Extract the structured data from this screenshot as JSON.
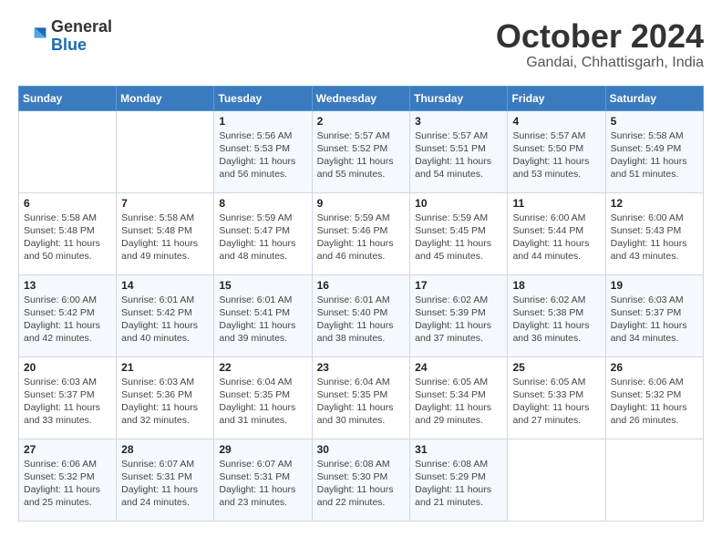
{
  "header": {
    "logo_line1": "General",
    "logo_line2": "Blue",
    "title": "October 2024",
    "subtitle": "Gandai, Chhattisgarh, India"
  },
  "days_of_week": [
    "Sunday",
    "Monday",
    "Tuesday",
    "Wednesday",
    "Thursday",
    "Friday",
    "Saturday"
  ],
  "weeks": [
    [
      {
        "day": "",
        "info": ""
      },
      {
        "day": "",
        "info": ""
      },
      {
        "day": "1",
        "info": "Sunrise: 5:56 AM\nSunset: 5:53 PM\nDaylight: 11 hours and 56 minutes."
      },
      {
        "day": "2",
        "info": "Sunrise: 5:57 AM\nSunset: 5:52 PM\nDaylight: 11 hours and 55 minutes."
      },
      {
        "day": "3",
        "info": "Sunrise: 5:57 AM\nSunset: 5:51 PM\nDaylight: 11 hours and 54 minutes."
      },
      {
        "day": "4",
        "info": "Sunrise: 5:57 AM\nSunset: 5:50 PM\nDaylight: 11 hours and 53 minutes."
      },
      {
        "day": "5",
        "info": "Sunrise: 5:58 AM\nSunset: 5:49 PM\nDaylight: 11 hours and 51 minutes."
      }
    ],
    [
      {
        "day": "6",
        "info": "Sunrise: 5:58 AM\nSunset: 5:48 PM\nDaylight: 11 hours and 50 minutes."
      },
      {
        "day": "7",
        "info": "Sunrise: 5:58 AM\nSunset: 5:48 PM\nDaylight: 11 hours and 49 minutes."
      },
      {
        "day": "8",
        "info": "Sunrise: 5:59 AM\nSunset: 5:47 PM\nDaylight: 11 hours and 48 minutes."
      },
      {
        "day": "9",
        "info": "Sunrise: 5:59 AM\nSunset: 5:46 PM\nDaylight: 11 hours and 46 minutes."
      },
      {
        "day": "10",
        "info": "Sunrise: 5:59 AM\nSunset: 5:45 PM\nDaylight: 11 hours and 45 minutes."
      },
      {
        "day": "11",
        "info": "Sunrise: 6:00 AM\nSunset: 5:44 PM\nDaylight: 11 hours and 44 minutes."
      },
      {
        "day": "12",
        "info": "Sunrise: 6:00 AM\nSunset: 5:43 PM\nDaylight: 11 hours and 43 minutes."
      }
    ],
    [
      {
        "day": "13",
        "info": "Sunrise: 6:00 AM\nSunset: 5:42 PM\nDaylight: 11 hours and 42 minutes."
      },
      {
        "day": "14",
        "info": "Sunrise: 6:01 AM\nSunset: 5:42 PM\nDaylight: 11 hours and 40 minutes."
      },
      {
        "day": "15",
        "info": "Sunrise: 6:01 AM\nSunset: 5:41 PM\nDaylight: 11 hours and 39 minutes."
      },
      {
        "day": "16",
        "info": "Sunrise: 6:01 AM\nSunset: 5:40 PM\nDaylight: 11 hours and 38 minutes."
      },
      {
        "day": "17",
        "info": "Sunrise: 6:02 AM\nSunset: 5:39 PM\nDaylight: 11 hours and 37 minutes."
      },
      {
        "day": "18",
        "info": "Sunrise: 6:02 AM\nSunset: 5:38 PM\nDaylight: 11 hours and 36 minutes."
      },
      {
        "day": "19",
        "info": "Sunrise: 6:03 AM\nSunset: 5:37 PM\nDaylight: 11 hours and 34 minutes."
      }
    ],
    [
      {
        "day": "20",
        "info": "Sunrise: 6:03 AM\nSunset: 5:37 PM\nDaylight: 11 hours and 33 minutes."
      },
      {
        "day": "21",
        "info": "Sunrise: 6:03 AM\nSunset: 5:36 PM\nDaylight: 11 hours and 32 minutes."
      },
      {
        "day": "22",
        "info": "Sunrise: 6:04 AM\nSunset: 5:35 PM\nDaylight: 11 hours and 31 minutes."
      },
      {
        "day": "23",
        "info": "Sunrise: 6:04 AM\nSunset: 5:35 PM\nDaylight: 11 hours and 30 minutes."
      },
      {
        "day": "24",
        "info": "Sunrise: 6:05 AM\nSunset: 5:34 PM\nDaylight: 11 hours and 29 minutes."
      },
      {
        "day": "25",
        "info": "Sunrise: 6:05 AM\nSunset: 5:33 PM\nDaylight: 11 hours and 27 minutes."
      },
      {
        "day": "26",
        "info": "Sunrise: 6:06 AM\nSunset: 5:32 PM\nDaylight: 11 hours and 26 minutes."
      }
    ],
    [
      {
        "day": "27",
        "info": "Sunrise: 6:06 AM\nSunset: 5:32 PM\nDaylight: 11 hours and 25 minutes."
      },
      {
        "day": "28",
        "info": "Sunrise: 6:07 AM\nSunset: 5:31 PM\nDaylight: 11 hours and 24 minutes."
      },
      {
        "day": "29",
        "info": "Sunrise: 6:07 AM\nSunset: 5:31 PM\nDaylight: 11 hours and 23 minutes."
      },
      {
        "day": "30",
        "info": "Sunrise: 6:08 AM\nSunset: 5:30 PM\nDaylight: 11 hours and 22 minutes."
      },
      {
        "day": "31",
        "info": "Sunrise: 6:08 AM\nSunset: 5:29 PM\nDaylight: 11 hours and 21 minutes."
      },
      {
        "day": "",
        "info": ""
      },
      {
        "day": "",
        "info": ""
      }
    ]
  ]
}
